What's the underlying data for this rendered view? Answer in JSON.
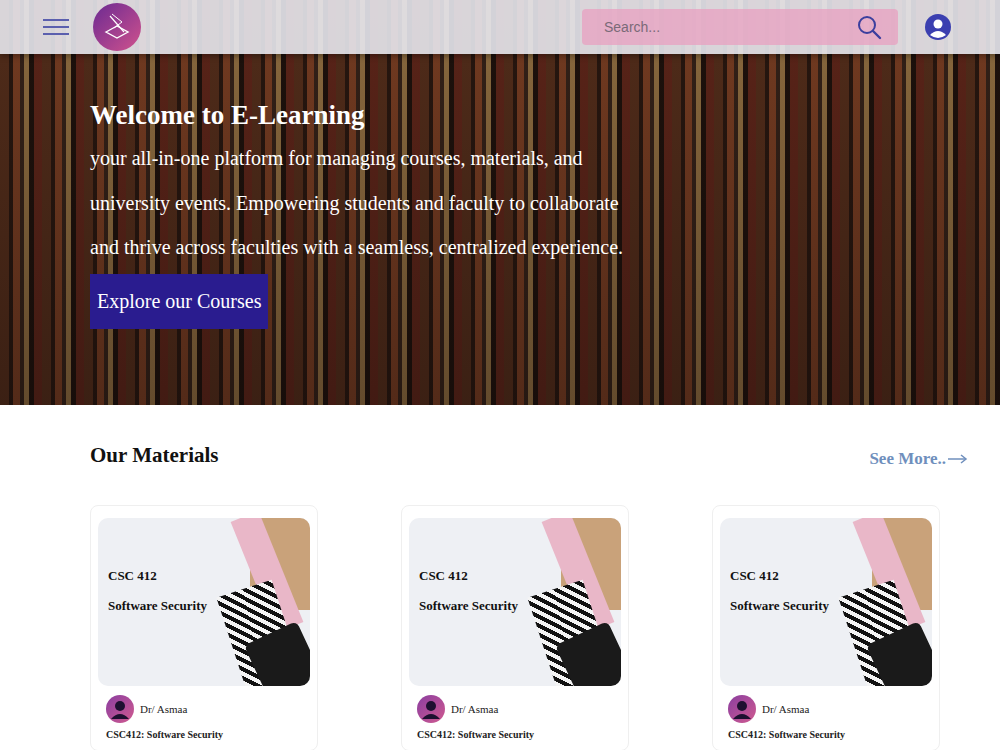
{
  "header": {
    "search": {
      "placeholder": "Search..."
    }
  },
  "hero": {
    "title": "Welcome to E-Learning",
    "text": "your all-in-one platform for managing courses, materials, and university events. Empowering students and faculty to collaborate and thrive across faculties with a seamless, centralized experience.",
    "button": "Explore our Courses"
  },
  "materials": {
    "title": "Our Materials",
    "see_more": "See More..",
    "cards": [
      {
        "cover_code": "CSC 412",
        "cover_title": "Software Security",
        "instructor": "Dr/ Asmaa",
        "course": "CSC412: Software Security"
      },
      {
        "cover_code": "CSC 412",
        "cover_title": "Software Security",
        "instructor": "Dr/ Asmaa",
        "course": "CSC412: Software Security"
      },
      {
        "cover_code": "CSC 412",
        "cover_title": "Software Security",
        "instructor": "Dr/ Asmaa",
        "course": "CSC412: Software Security"
      }
    ]
  }
}
